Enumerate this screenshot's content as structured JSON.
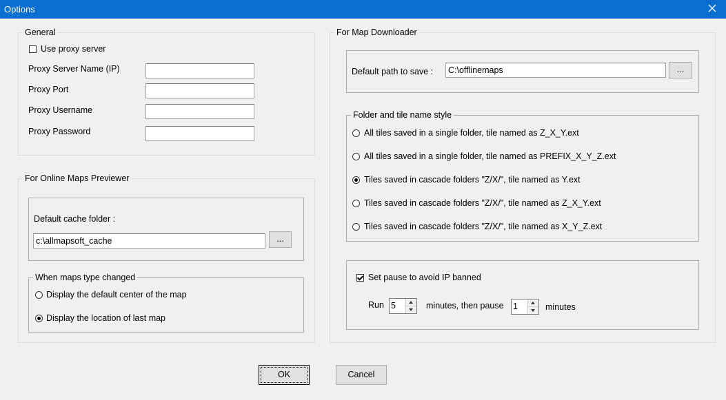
{
  "window": {
    "title": "Options",
    "close_icon": "close-icon"
  },
  "general": {
    "legend": "General",
    "use_proxy": {
      "label": "Use proxy server",
      "checked": false
    },
    "server_name_label": "Proxy Server Name (IP)",
    "server_name_value": "",
    "port_label": "Proxy Port",
    "port_value": "",
    "username_label": "Proxy Username",
    "username_value": "",
    "password_label": "Proxy Password",
    "password_value": ""
  },
  "previewer": {
    "legend": "For Online Maps Previewer",
    "cache_label": "Default cache folder :",
    "cache_value": "c:\\allmapsoft_cache",
    "browse_label": "...",
    "maps_changed": {
      "legend": "When maps type changed",
      "option1": "Display the default center of the map",
      "option2": "Display the location of last map",
      "selected": 2
    }
  },
  "downloader": {
    "legend": "For Map Downloader",
    "path_label": "Default path to save :",
    "path_value": "C:\\offlinemaps",
    "browse_label": "...",
    "style": {
      "legend": "Folder and tile name style",
      "options": [
        "All tiles saved in a single folder, tile named as Z_X_Y.ext",
        "All tiles saved in a single folder, tile named as PREFIX_X_Y_Z.ext",
        "Tiles saved in cascade folders \"Z/X/\", tile named as Y.ext",
        "Tiles saved in cascade folders \"Z/X/\", tile named as Z_X_Y.ext",
        "Tiles saved in cascade folders \"Z/X/\", tile named as X_Y_Z.ext"
      ],
      "selected": 3
    },
    "pause": {
      "label": "Set pause to avoid IP banned",
      "checked": true,
      "run_label": "Run",
      "run_value": "5",
      "minutes_then_pause": "minutes, then pause",
      "pause_value": "1",
      "minutes_label": "minutes"
    }
  },
  "buttons": {
    "ok": "OK",
    "cancel": "Cancel"
  }
}
